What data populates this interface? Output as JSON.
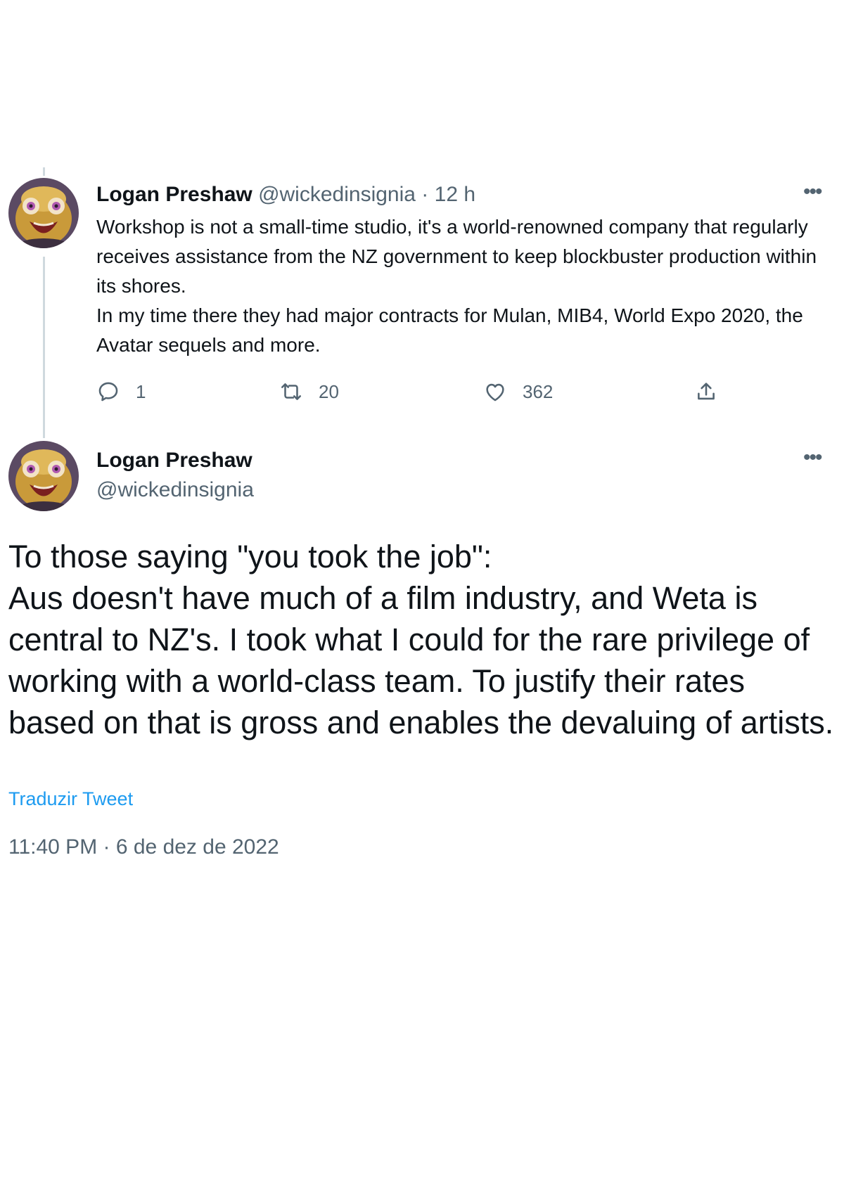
{
  "reply_tweet": {
    "author_name": "Logan Preshaw",
    "handle": "@wickedinsignia",
    "separator": "·",
    "time_ago": "12 h",
    "text_lines": [
      "Workshop is not a small-time studio, it's a world-renowned company that regularly receives assistance from the NZ government to keep blockbuster production within its shores.",
      "In my time there they had major contracts for Mulan, MIB4, World Expo 2020, the Avatar sequels and more."
    ],
    "actions": {
      "reply_count": "1",
      "retweet_count": "20",
      "like_count": "362"
    },
    "more_icon": "more-horizontal-icon"
  },
  "main_tweet": {
    "author_name": "Logan Preshaw",
    "handle": "@wickedinsignia",
    "text_lines": [
      "To those saying \"you took the job\":",
      "Aus doesn't have much of a film industry, and Weta is central to NZ's. I took what I could for the rare privilege of working with a world-class team. To justify their rates based on that is gross and enables the devaluing of artists."
    ],
    "translate_label": "Traduzir Tweet",
    "timestamp": "11:40 PM · 6 de dez de 2022",
    "more_icon": "more-horizontal-icon"
  },
  "colors": {
    "text": "#0f1419",
    "secondary": "#536471",
    "link": "#1d9bf0",
    "thread_line": "#cfd9de"
  },
  "icons": [
    "reply-icon",
    "retweet-icon",
    "like-icon",
    "share-icon",
    "more-horizontal-icon",
    "avatar"
  ]
}
